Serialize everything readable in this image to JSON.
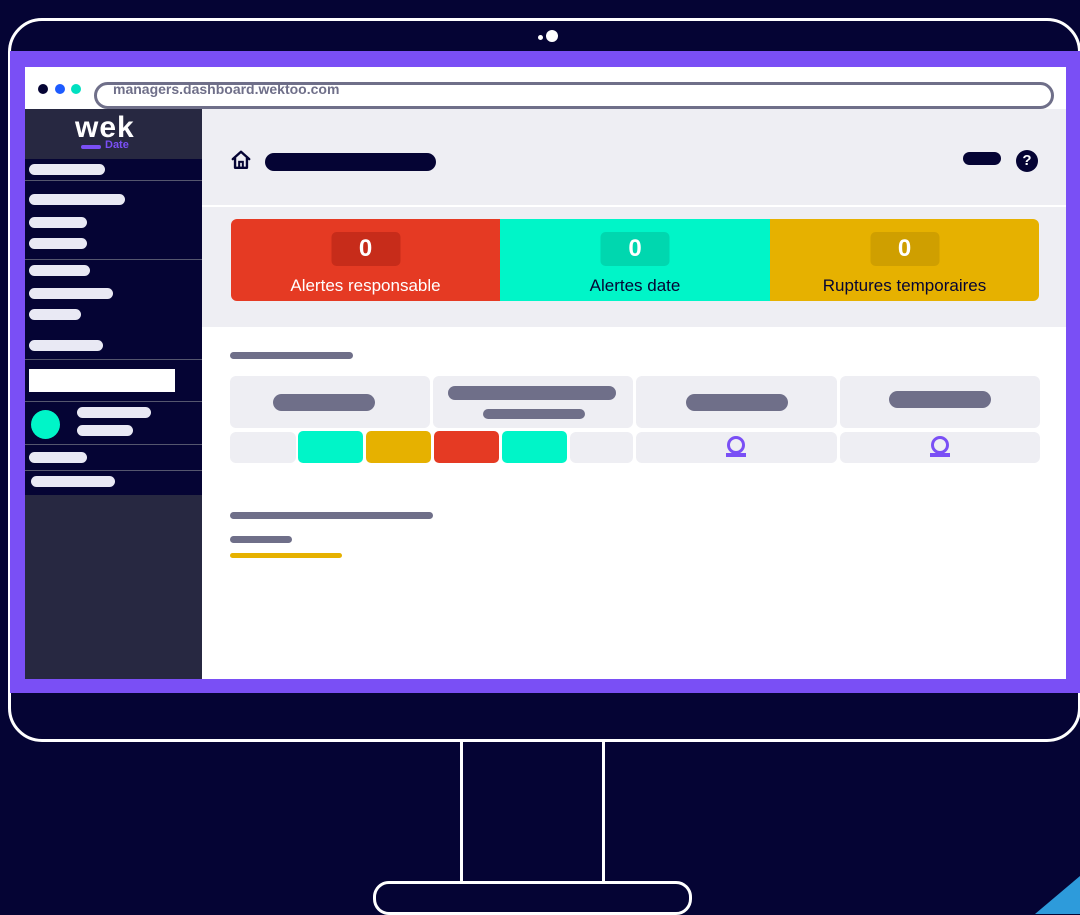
{
  "browser": {
    "url": "managers.dashboard.wektoo.com"
  },
  "sidebar": {
    "logo_text": "wek",
    "logo_sub": "Date"
  },
  "header": {
    "help_glyph": "?"
  },
  "alerts": [
    {
      "count": "0",
      "label": "Alertes responsable",
      "color": "#e53a23"
    },
    {
      "count": "0",
      "label": "Alertes date",
      "color": "#00f5c8"
    },
    {
      "count": "0",
      "label": "Ruptures temporaires",
      "color": "#e6b100"
    }
  ],
  "colors": {
    "background": "#050434",
    "accent_purple": "#7a4ff5",
    "red": "#e53a23",
    "teal": "#00f5c8",
    "yellow": "#e6b100",
    "grey": "#6f6f89"
  },
  "icons": [
    "home-icon",
    "help-icon",
    "user-status-icon"
  ]
}
